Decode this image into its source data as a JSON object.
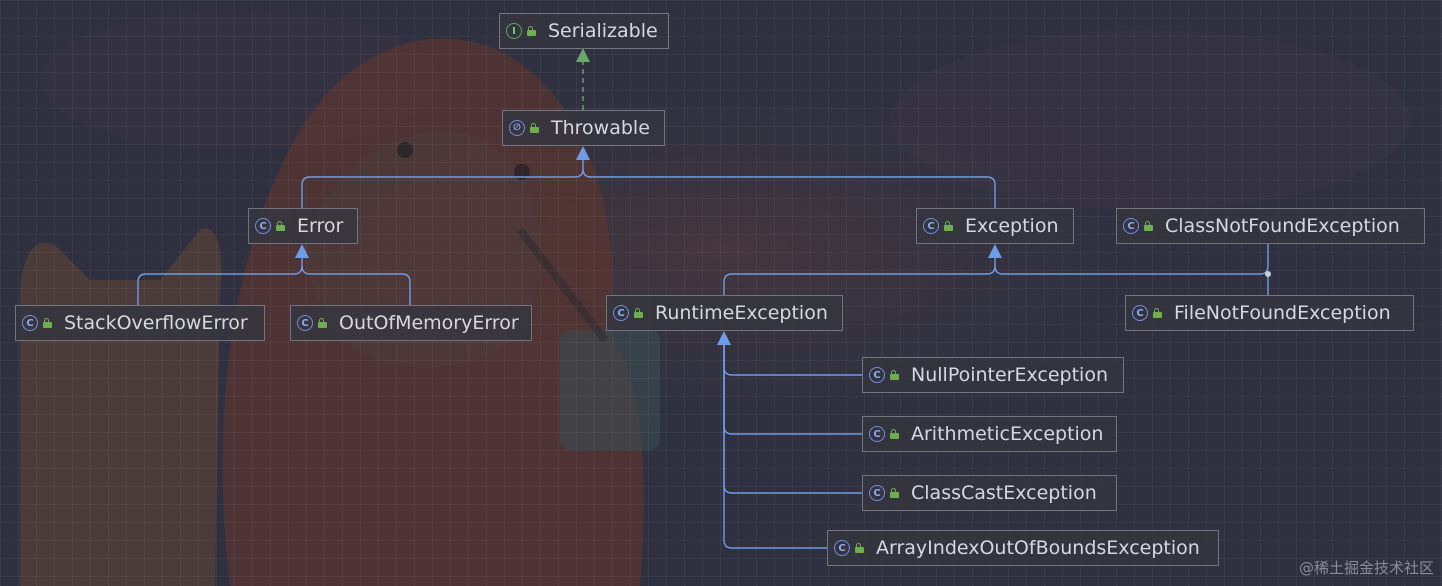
{
  "diagram": {
    "nodes": [
      {
        "id": "serializable",
        "label": "Serializable",
        "kind": "interface",
        "icon": "interface-icon"
      },
      {
        "id": "throwable",
        "label": "Throwable",
        "kind": "abstract-class",
        "icon": "abstract-class-icon"
      },
      {
        "id": "error",
        "label": "Error",
        "kind": "class",
        "icon": "class-icon"
      },
      {
        "id": "exception",
        "label": "Exception",
        "kind": "class",
        "icon": "class-icon"
      },
      {
        "id": "classnotfound",
        "label": "ClassNotFoundException",
        "kind": "class",
        "icon": "class-icon"
      },
      {
        "id": "stackoverflow",
        "label": "StackOverflowError",
        "kind": "class",
        "icon": "class-icon"
      },
      {
        "id": "outofmemory",
        "label": "OutOfMemoryError",
        "kind": "class",
        "icon": "class-icon"
      },
      {
        "id": "runtime",
        "label": "RuntimeException",
        "kind": "class",
        "icon": "class-icon"
      },
      {
        "id": "filenotfound",
        "label": "FileNotFoundException",
        "kind": "class",
        "icon": "class-icon"
      },
      {
        "id": "nullpointer",
        "label": "NullPointerException",
        "kind": "class",
        "icon": "class-icon"
      },
      {
        "id": "arithmetic",
        "label": "ArithmeticException",
        "kind": "class",
        "icon": "class-icon"
      },
      {
        "id": "classcast",
        "label": "ClassCastException",
        "kind": "class",
        "icon": "class-icon"
      },
      {
        "id": "arrayindex",
        "label": "ArrayIndexOutOfBoundsException",
        "kind": "class",
        "icon": "class-icon"
      }
    ],
    "edges": [
      {
        "from": "throwable",
        "to": "serializable",
        "type": "implements"
      },
      {
        "from": "error",
        "to": "throwable",
        "type": "extends"
      },
      {
        "from": "exception",
        "to": "throwable",
        "type": "extends"
      },
      {
        "from": "stackoverflow",
        "to": "error",
        "type": "extends"
      },
      {
        "from": "outofmemory",
        "to": "error",
        "type": "extends"
      },
      {
        "from": "runtime",
        "to": "exception",
        "type": "extends"
      },
      {
        "from": "classnotfound",
        "to": "exception",
        "type": "extends"
      },
      {
        "from": "filenotfound",
        "to": "exception",
        "type": "extends"
      },
      {
        "from": "nullpointer",
        "to": "runtime",
        "type": "extends"
      },
      {
        "from": "arithmetic",
        "to": "runtime",
        "type": "extends"
      },
      {
        "from": "classcast",
        "to": "runtime",
        "type": "extends"
      },
      {
        "from": "arrayindex",
        "to": "runtime",
        "type": "extends"
      }
    ],
    "colors": {
      "extends_edge": "#6f9ce8",
      "implements_edge": "#6aa86a",
      "background": "#2f3140"
    }
  },
  "watermark": "@稀土掘金技术社区"
}
